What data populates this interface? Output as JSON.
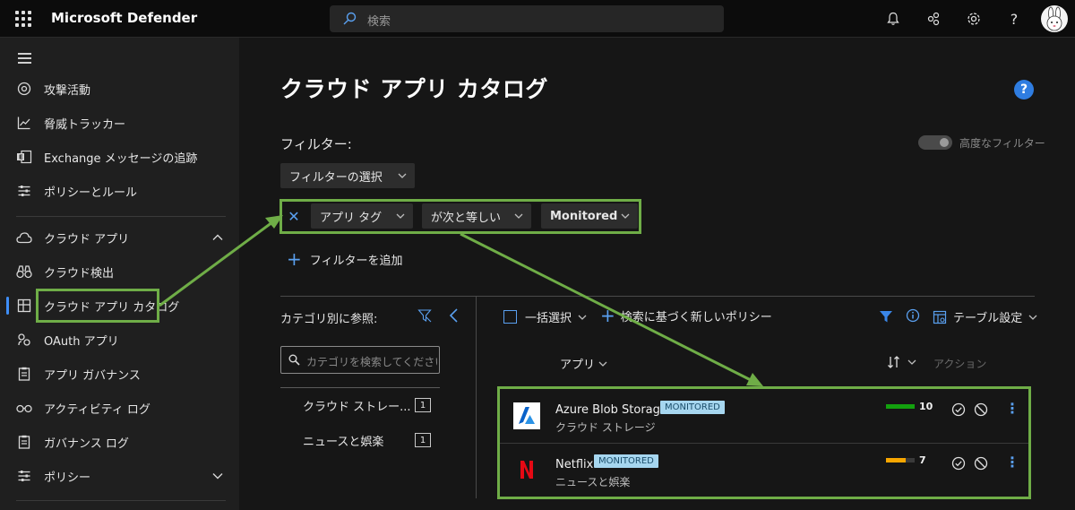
{
  "header": {
    "app_title": "Microsoft Defender",
    "search_placeholder": "検索"
  },
  "sidebar": {
    "items": [
      {
        "label": "攻撃活動",
        "icon": "target-icon"
      },
      {
        "label": "脅威トラッカー",
        "icon": "chart-icon"
      },
      {
        "label": "Exchange メッセージの追跡",
        "icon": "exchange-icon"
      },
      {
        "label": "ポリシーとルール",
        "icon": "sliders-icon"
      },
      {
        "label": "クラウド アプリ",
        "icon": "cloud-icon"
      },
      {
        "label": "クラウド検出",
        "icon": "binoculars-icon"
      },
      {
        "label": "クラウド アプリ カタログ",
        "icon": "catalog-icon"
      },
      {
        "label": "OAuth アプリ",
        "icon": "oauth-icon"
      },
      {
        "label": "アプリ ガバナンス",
        "icon": "governance-icon"
      },
      {
        "label": "アクティビティ ログ",
        "icon": "glasses-icon"
      },
      {
        "label": "ガバナンス ログ",
        "icon": "log-icon"
      },
      {
        "label": "ポリシー",
        "icon": "sliders-icon"
      }
    ]
  },
  "main": {
    "title": "クラウド アプリ カタログ",
    "filter_label": "フィルター:",
    "advanced_filter_label": "高度なフィルター",
    "filter_select_label": "フィルターの選択",
    "filter_row": {
      "field": "アプリ タグ",
      "operator": "が次と等しい",
      "value": "Monitored"
    },
    "add_filter_label": "フィルターを追加",
    "category_panel": {
      "title": "カテゴリ別に参照:",
      "search_placeholder": "カテゴリを検索してください",
      "categories": [
        {
          "name": "クラウド ストレー...",
          "count": "1"
        },
        {
          "name": "ニュースと娯楽",
          "count": "1"
        }
      ]
    },
    "toolbar": {
      "bulk_select_label": "一括選択",
      "new_policy_label": "検索に基づく新しいポリシー",
      "table_settings_label": "テーブル設定"
    },
    "table": {
      "col_app": "アプリ",
      "col_action": "アクション",
      "rows": [
        {
          "name": "Azure Blob Storage",
          "badge": "MONITORED",
          "category": "クラウド ストレージ",
          "score": "10",
          "score_fraction": 1.0,
          "score_color": "#13a10e"
        },
        {
          "name": "Netflix",
          "badge": "MONITORED",
          "category": "ニュースと娯楽",
          "score": "7",
          "score_fraction": 0.7,
          "score_color": "#f7a600"
        }
      ]
    }
  },
  "colors": {
    "accent": "#5aa0f0",
    "annotation_green": "#6fad47"
  }
}
